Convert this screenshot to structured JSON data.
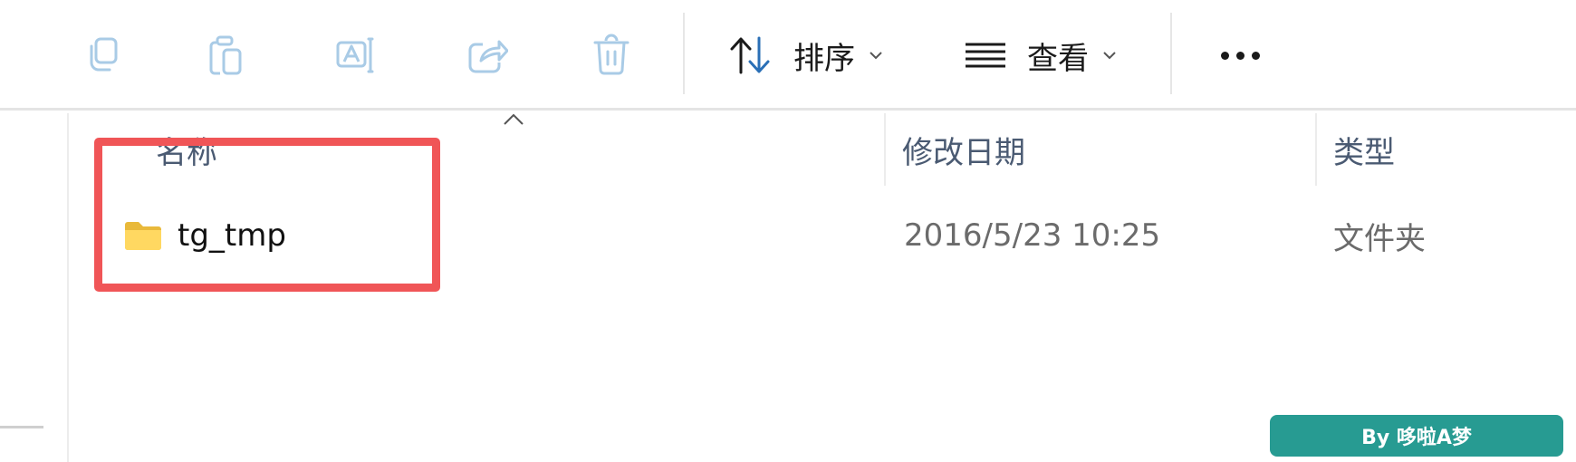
{
  "toolbar": {
    "copy_icon": "copy-icon",
    "paste_icon": "paste-icon",
    "rename_icon": "rename-icon",
    "share_icon": "share-icon",
    "delete_icon": "delete-icon",
    "sort_label": "排序",
    "view_label": "查看",
    "more_icon": "more-icon"
  },
  "columns": {
    "name": "名称",
    "modified": "修改日期",
    "type": "类型"
  },
  "rows": [
    {
      "name": "tg_tmp",
      "modified": "2016/5/23 10:25",
      "type": "文件夹",
      "icon": "folder-icon"
    }
  ],
  "watermark": "By 哆啦A梦",
  "colors": {
    "highlight": "#f05557",
    "badge": "#279b92",
    "disabled_icon": "#a9cbe6",
    "sort_arrow": "#2a6fb6"
  }
}
